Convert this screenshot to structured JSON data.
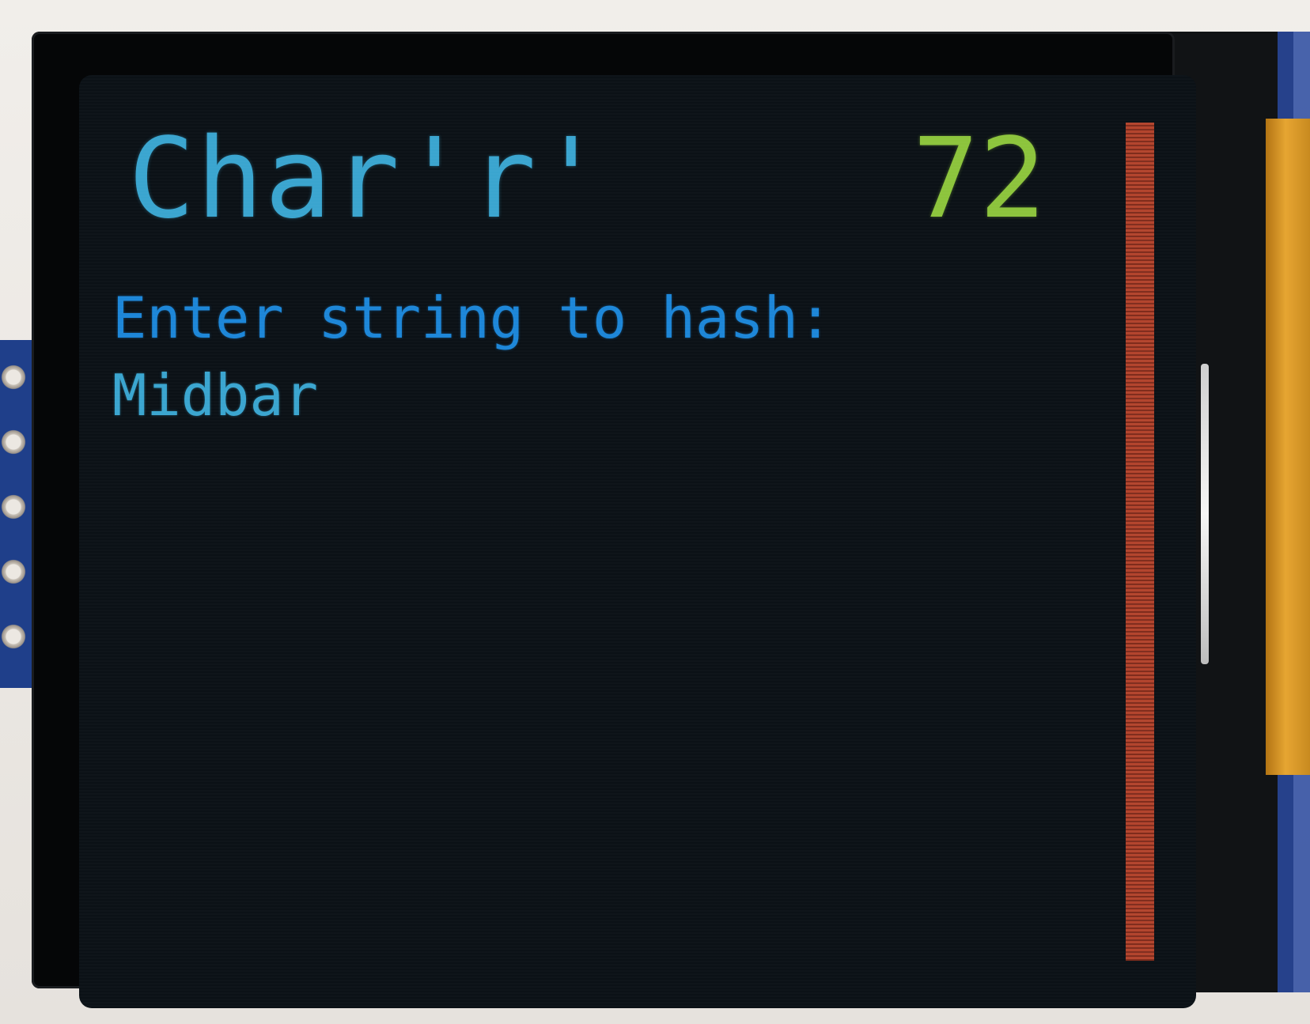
{
  "screen": {
    "title": "Char'r'",
    "counter": "72",
    "prompt": "Enter string to hash:",
    "input_value": "Midbar"
  },
  "level_bar": {
    "fill_percent": 100
  },
  "colors": {
    "background": "#0b1116",
    "title": "#3aa5cf",
    "counter": "#8cc43c",
    "prompt": "#1c86d8",
    "input": "#3aa5cf",
    "level_bar": "#b3442d"
  }
}
